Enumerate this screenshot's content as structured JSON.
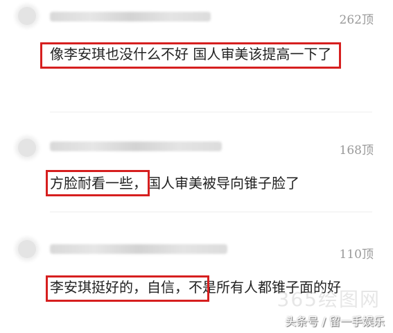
{
  "comments": [
    {
      "likes": "262顶",
      "text": "像李安琪也没什么不好 国人审美该提高一下了"
    },
    {
      "likes": "168顶",
      "text": "方脸耐看一些，国人审美被导向锥子脸了"
    },
    {
      "likes": "110顶",
      "text": "李安琪挺好的，自信，不是所有人都锥子面的好"
    }
  ],
  "watermark": {
    "site": "365绘图网",
    "source": "头条号 / 留一手娱乐"
  },
  "colors": {
    "highlight": "#d61f1f",
    "likes": "#999999",
    "text": "#222222"
  }
}
